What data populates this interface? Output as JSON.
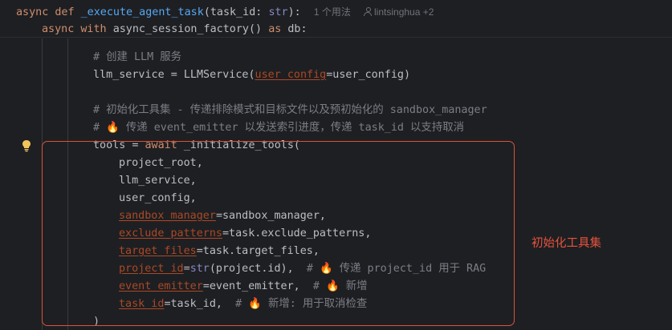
{
  "header": {
    "line1": {
      "kw_async": "async",
      "kw_def": "def",
      "func_name": "_execute_agent_task",
      "params": "(task_id: ",
      "type": "str",
      "end": "):",
      "usages": "1 个用法",
      "author": "lintsinghua +2"
    },
    "line2": {
      "kw_async": "async",
      "kw_with": "with",
      "call": "async_session_factory()",
      "kw_as": "as",
      "rest": "db:"
    }
  },
  "code": {
    "c1": "# 创建 LLM 服务",
    "l2_a": "llm_service = LLMService(",
    "l2_param": "user_config",
    "l2_b": "=user_config)",
    "c3": "# 初始化工具集 - 传递排除模式和目标文件以及预初始化的 sandbox_manager",
    "c4_a": "#",
    "c4_b": "传递 event_emitter 以发送索引进度，传递 task_id 以支持取消",
    "l5_a": "tools = ",
    "l5_kw": "await",
    "l5_b": "_initialize_tools(",
    "a1": "project_root,",
    "a2": "llm_service,",
    "a3": "user_config,",
    "a4_param": "sandbox_manager",
    "a4_b": "=sandbox_manager,",
    "a5_param": "exclude_patterns",
    "a5_b": "=task.exclude_patterns,",
    "a6_param": "target_files",
    "a6_b": "=task.target_files,",
    "a7_param": "project_id",
    "a7_eq": "=",
    "a7_builtin": "str",
    "a7_b": "(project.id),",
    "a7_c_hash": "#",
    "a7_c": "传递 project_id 用于 RAG",
    "a8_param": "event_emitter",
    "a8_b": "=event_emitter,",
    "a8_c_hash": "#",
    "a8_c": "新增",
    "a9_param": "task_id",
    "a9_b": "=task_id,",
    "a9_c_hash": "#",
    "a9_c": "新增: 用于取消检查",
    "close": ")"
  },
  "annotation": {
    "label": "初始化工具集"
  },
  "icons": {
    "fire": "🔥",
    "bulb": "lightbulb-icon",
    "person": "person-icon"
  },
  "colors": {
    "background": "#1e1f22",
    "keyword": "#cf8e6d",
    "function": "#56a8f5",
    "param": "#aa4926",
    "comment": "#7a7e85",
    "highlight": "#d9533c"
  }
}
